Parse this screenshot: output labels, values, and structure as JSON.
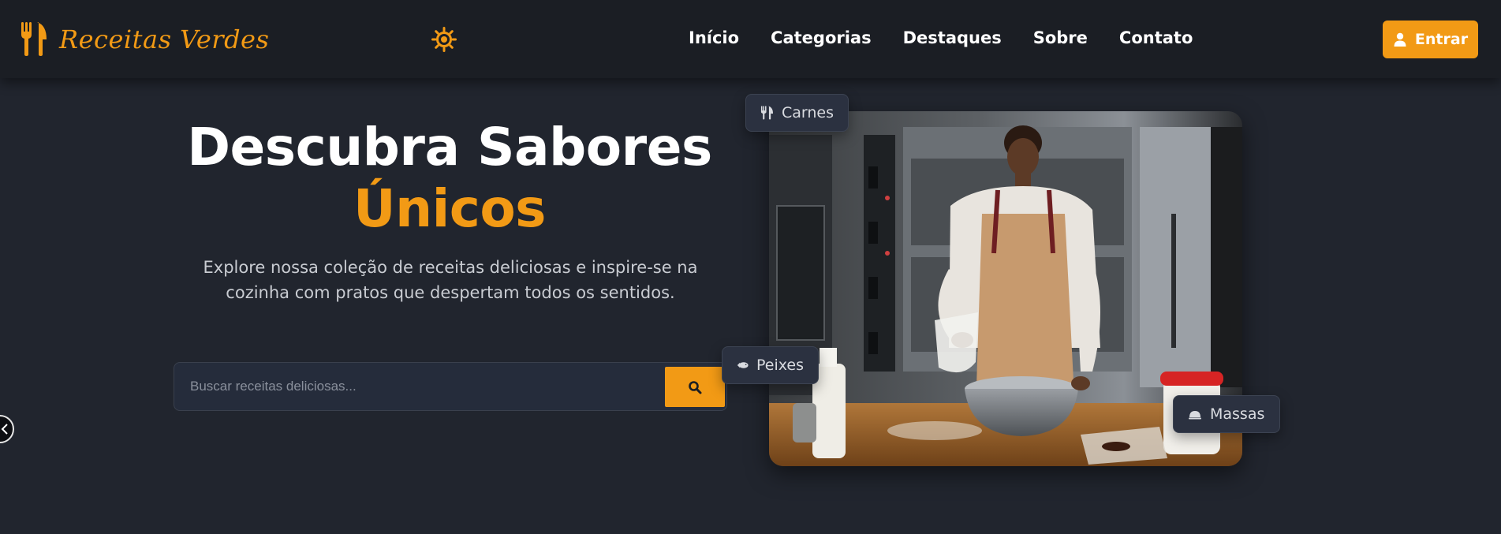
{
  "brand": {
    "name": "Receitas Verdes",
    "accent_color": "#f29a15",
    "logo_icon": "fork-knife-icon"
  },
  "header": {
    "theme_icon": "sun-icon",
    "nav": [
      {
        "label": "Início"
      },
      {
        "label": "Categorias"
      },
      {
        "label": "Destaques"
      },
      {
        "label": "Sobre"
      },
      {
        "label": "Contato"
      }
    ],
    "login_label": "Entrar",
    "login_icon": "user-icon"
  },
  "hero": {
    "title_line1": "Descubra Sabores",
    "title_line2": "Únicos",
    "subtitle": "Explore nossa coleção de receitas deliciosas e inspire-se na cozinha com pratos que despertam todos os sentidos.",
    "search": {
      "placeholder": "Buscar receitas deliciosas...",
      "button_icon": "search-icon"
    },
    "tags": [
      {
        "label": "Carnes",
        "icon": "utensils-icon"
      },
      {
        "label": "Peixes",
        "icon": "fish-icon"
      },
      {
        "label": "Massas",
        "icon": "cloche-icon"
      }
    ]
  },
  "colors": {
    "background": "#21252e",
    "navbar": "#1b1e24",
    "accent": "#f29a15"
  }
}
